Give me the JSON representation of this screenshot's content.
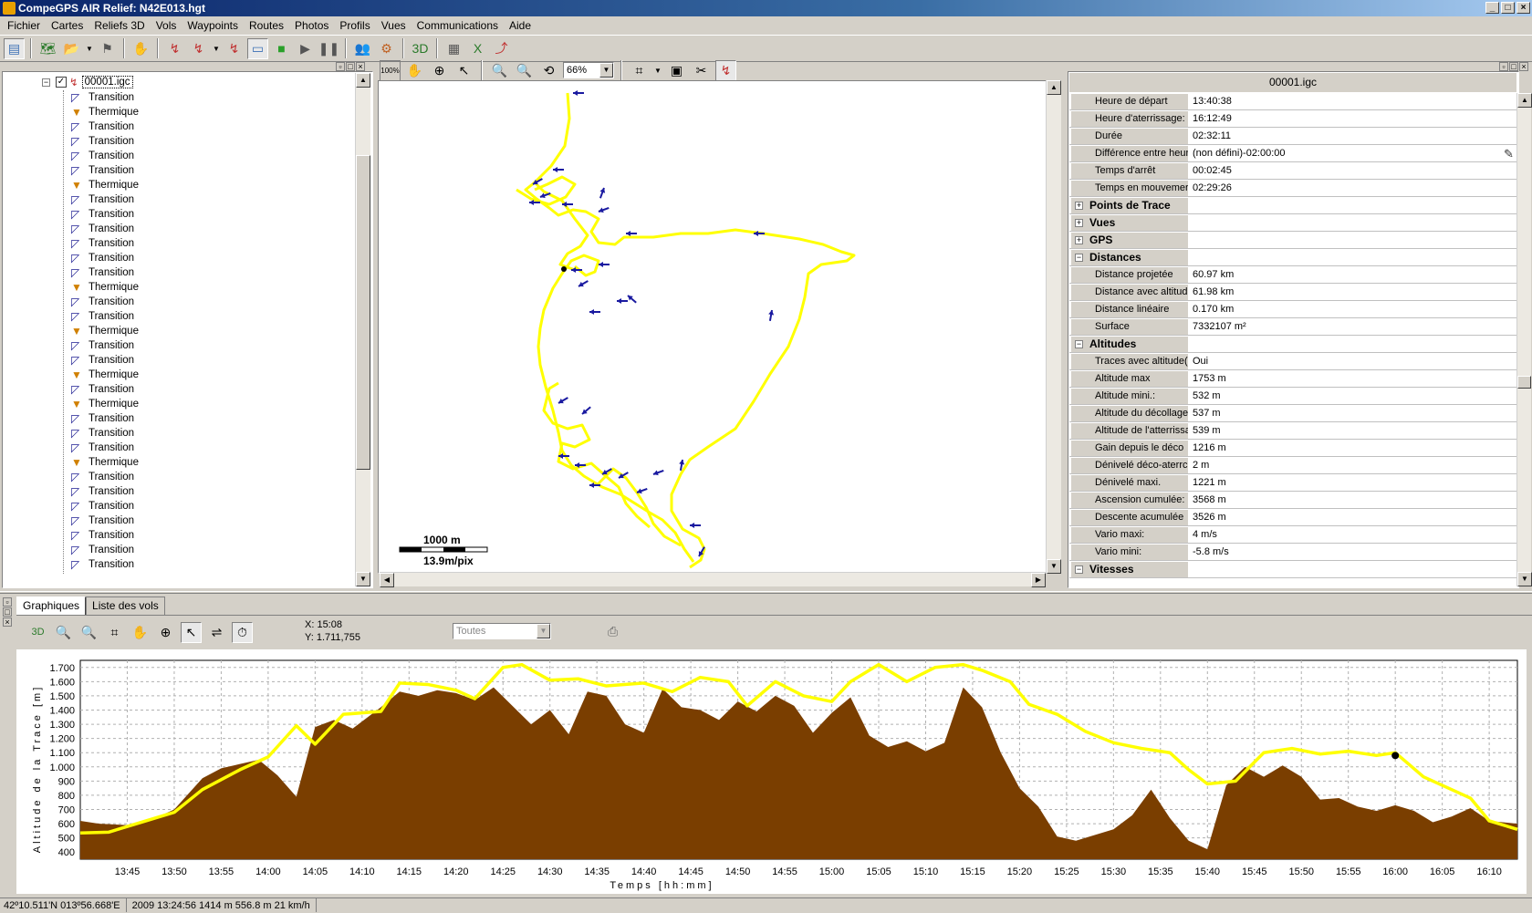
{
  "window": {
    "title": "CompeGPS AIR Relief: N42E013.hgt"
  },
  "menu": [
    "Fichier",
    "Cartes",
    "Reliefs 3D",
    "Vols",
    "Waypoints",
    "Routes",
    "Photos",
    "Profils",
    "Vues",
    "Communications",
    "Aide"
  ],
  "tree": {
    "root": "00001.igc",
    "items": [
      "Transition",
      "Thermique",
      "Transition",
      "Transition",
      "Transition",
      "Transition",
      "Thermique",
      "Transition",
      "Transition",
      "Transition",
      "Transition",
      "Transition",
      "Transition",
      "Thermique",
      "Transition",
      "Transition",
      "Thermique",
      "Transition",
      "Transition",
      "Thermique",
      "Transition",
      "Thermique",
      "Transition",
      "Transition",
      "Transition",
      "Thermique",
      "Transition",
      "Transition",
      "Transition",
      "Transition",
      "Transition",
      "Transition",
      "Transition"
    ]
  },
  "map": {
    "zoom_label": "100%",
    "zoom_value": "66%",
    "scale_distance": "1000 m",
    "scale_resolution": "13.9m/pix",
    "track_color": "#ffff00",
    "arrow_color": "#1a1aa0"
  },
  "properties": {
    "title": "00001.igc",
    "rows": [
      {
        "type": "row",
        "key": "Heure de départ",
        "value": "13:40:38"
      },
      {
        "type": "row",
        "key": "Heure d'aterrissage:",
        "value": "16:12:49"
      },
      {
        "type": "row",
        "key": "Durée",
        "value": "02:32:11"
      },
      {
        "type": "row",
        "key": "Différence entre heur",
        "value": "(non défini)-02:00:00"
      },
      {
        "type": "row",
        "key": "Temps d'arrêt",
        "value": "00:02:45"
      },
      {
        "type": "row",
        "key": "Temps en mouvemer",
        "value": "02:29:26"
      },
      {
        "type": "section",
        "key": "Points de Trace",
        "sign": "+",
        "value": ""
      },
      {
        "type": "section",
        "key": "Vues",
        "sign": "+",
        "value": ""
      },
      {
        "type": "section",
        "key": "GPS",
        "sign": "+",
        "value": ""
      },
      {
        "type": "section",
        "key": "Distances",
        "sign": "−",
        "value": ""
      },
      {
        "type": "row",
        "key": "Distance projetée",
        "value": "60.97 km"
      },
      {
        "type": "row",
        "key": "Distance avec altitud",
        "value": "61.98 km"
      },
      {
        "type": "row",
        "key": "Distance linéaire",
        "value": "0.170 km"
      },
      {
        "type": "row",
        "key": "Surface",
        "value": "7332107 m²"
      },
      {
        "type": "section",
        "key": "Altitudes",
        "sign": "−",
        "value": ""
      },
      {
        "type": "row",
        "key": "Traces avec altitude(",
        "value": "Oui"
      },
      {
        "type": "row",
        "key": "Altitude max",
        "value": "1753 m"
      },
      {
        "type": "row",
        "key": "Altitude mini.:",
        "value": "532 m"
      },
      {
        "type": "row",
        "key": "Altitude du décollage:",
        "value": "537 m"
      },
      {
        "type": "row",
        "key": "Altitude de l'atterrissa",
        "value": "539 m"
      },
      {
        "type": "row",
        "key": "Gain depuis le déco",
        "value": "1216 m"
      },
      {
        "type": "row",
        "key": "Dénivelé déco-aterrc",
        "value": "2 m"
      },
      {
        "type": "row",
        "key": "Dénivelé maxi.",
        "value": "1221 m"
      },
      {
        "type": "row",
        "key": "Ascension cumulée:",
        "value": "3568 m"
      },
      {
        "type": "row",
        "key": "Descente acumulée",
        "value": "3526 m"
      },
      {
        "type": "row",
        "key": "Vario maxi:",
        "value": "4 m/s"
      },
      {
        "type": "row",
        "key": "Vario mini:",
        "value": "-5.8 m/s"
      },
      {
        "type": "section",
        "key": "Vitesses",
        "sign": "−",
        "value": ""
      }
    ]
  },
  "bottom": {
    "tabs": [
      "Graphiques",
      "Liste des vols"
    ],
    "cursor_x": "X: 15:08",
    "cursor_y": "Y: 1.711,755",
    "filter": "Toutes"
  },
  "chart_data": {
    "type": "area",
    "ylabel": "Altitude de la Trace [m]",
    "xlabel": "Temps [hh:mm]",
    "ylim": [
      350,
      1750
    ],
    "xlim": [
      "13:40",
      "16:13"
    ],
    "yticks": [
      "1.700",
      "1.600",
      "1.500",
      "1.400",
      "1.300",
      "1.200",
      "1.100",
      "1.000",
      "900",
      "800",
      "700",
      "600",
      "500",
      "400"
    ],
    "xticks": [
      "13:45",
      "13:50",
      "13:55",
      "14:00",
      "14:05",
      "14:10",
      "14:15",
      "14:20",
      "14:25",
      "14:30",
      "14:35",
      "14:40",
      "14:45",
      "14:50",
      "14:55",
      "15:00",
      "15:05",
      "15:10",
      "15:15",
      "15:20",
      "15:25",
      "15:30",
      "15:35",
      "15:40",
      "15:45",
      "15:50",
      "15:55",
      "16:00",
      "16:05",
      "16:10"
    ],
    "series": [
      {
        "color": "#ffff00",
        "x": [
          "13:40",
          "13:43",
          "13:47",
          "13:50",
          "13:53",
          "13:57",
          "14:00",
          "14:03",
          "14:05",
          "14:08",
          "14:12",
          "14:14",
          "14:17",
          "14:20",
          "14:22",
          "14:25",
          "14:27",
          "14:30",
          "14:33",
          "14:36",
          "14:40",
          "14:43",
          "14:46",
          "14:49",
          "14:51",
          "14:54",
          "14:57",
          "15:00",
          "15:02",
          "15:05",
          "15:08",
          "15:11",
          "15:14",
          "15:16",
          "15:19",
          "15:21",
          "15:24",
          "15:27",
          "15:30",
          "15:33",
          "15:36",
          "15:38",
          "15:40",
          "15:43",
          "15:46",
          "15:49",
          "15:52",
          "15:55",
          "15:58",
          "16:00",
          "16:03",
          "16:06",
          "16:08",
          "16:10",
          "16:13"
        ],
        "values": [
          535,
          540,
          620,
          680,
          840,
          980,
          1070,
          1290,
          1160,
          1370,
          1390,
          1590,
          1580,
          1540,
          1480,
          1700,
          1720,
          1610,
          1620,
          1570,
          1590,
          1530,
          1630,
          1600,
          1430,
          1600,
          1500,
          1460,
          1600,
          1720,
          1600,
          1700,
          1720,
          1680,
          1600,
          1440,
          1370,
          1250,
          1170,
          1130,
          1100,
          980,
          880,
          900,
          1100,
          1130,
          1090,
          1110,
          1080,
          1100,
          930,
          840,
          780,
          620,
          560
        ]
      }
    ],
    "terrain": {
      "color": "#7a3e00",
      "x": [
        "13:40",
        "13:42",
        "13:45",
        "13:48",
        "13:50",
        "13:53",
        "13:55",
        "13:57",
        "13:59",
        "14:01",
        "14:03",
        "14:05",
        "14:07",
        "14:09",
        "14:12",
        "14:14",
        "14:16",
        "14:18",
        "14:20",
        "14:22",
        "14:24",
        "14:26",
        "14:28",
        "14:30",
        "14:32",
        "14:34",
        "14:36",
        "14:38",
        "14:40",
        "14:42",
        "14:44",
        "14:46",
        "14:48",
        "14:50",
        "14:52",
        "14:54",
        "14:56",
        "14:58",
        "15:00",
        "15:02",
        "15:04",
        "15:06",
        "15:08",
        "15:10",
        "15:12",
        "15:14",
        "15:16",
        "15:18",
        "15:20",
        "15:22",
        "15:24",
        "15:26",
        "15:28",
        "15:30",
        "15:32",
        "15:34",
        "15:36",
        "15:38",
        "15:40",
        "15:42",
        "15:44",
        "15:46",
        "15:48",
        "15:50",
        "15:52",
        "15:54",
        "15:56",
        "15:58",
        "16:00",
        "16:02",
        "16:04",
        "16:06",
        "16:08",
        "16:10",
        "16:13"
      ],
      "values": [
        620,
        600,
        590,
        640,
        700,
        920,
        990,
        1020,
        1050,
        940,
        790,
        1280,
        1330,
        1270,
        1420,
        1530,
        1500,
        1540,
        1520,
        1470,
        1560,
        1430,
        1300,
        1400,
        1230,
        1530,
        1500,
        1300,
        1240,
        1550,
        1420,
        1400,
        1330,
        1460,
        1390,
        1500,
        1430,
        1240,
        1380,
        1490,
        1220,
        1140,
        1180,
        1110,
        1170,
        1560,
        1420,
        1100,
        850,
        720,
        510,
        480,
        520,
        560,
        660,
        840,
        640,
        480,
        420,
        870,
        1000,
        930,
        1010,
        930,
        770,
        780,
        720,
        690,
        730,
        690,
        610,
        650,
        710,
        620,
        600
      ]
    }
  },
  "status": [
    "42º10.511'N 013º56.668'E",
    "2009 13:24:56  1414 m  556.8 m  21 km/h"
  ]
}
